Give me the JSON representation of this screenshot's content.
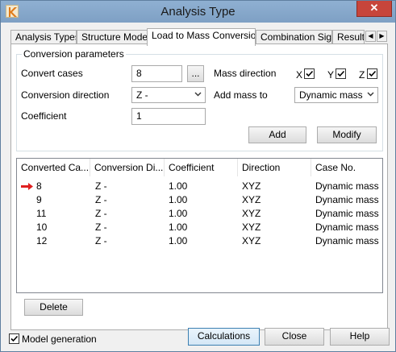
{
  "window": {
    "title": "Analysis Type"
  },
  "titlebar": {
    "close_glyph": "✕"
  },
  "tabs": [
    {
      "label": "Analysis Types"
    },
    {
      "label": "Structure Model"
    },
    {
      "label": "Load to Mass Conversion"
    },
    {
      "label": "Combination Sign"
    },
    {
      "label": "Result I"
    }
  ],
  "tab_scroll": {
    "left": "◀",
    "right": "▶"
  },
  "conversion": {
    "group_label": "Conversion parameters",
    "convert_cases_label": "Convert cases",
    "convert_cases_value": "8",
    "browse_label": "...",
    "direction_label": "Conversion direction",
    "direction_value": "Z -",
    "coefficient_label": "Coefficient",
    "coefficient_value": "1",
    "mass_direction_label": "Mass direction",
    "mass_x": "X",
    "mass_y": "Y",
    "mass_z": "Z",
    "add_mass_label": "Add mass to",
    "add_mass_value": "Dynamic mass",
    "add_button": "Add",
    "modify_button": "Modify"
  },
  "table": {
    "columns": [
      "Converted Ca...",
      "Conversion Di...",
      "Coefficient",
      "Direction",
      "Case No."
    ],
    "rows": [
      [
        "8",
        "Z -",
        "1.00",
        "XYZ",
        "Dynamic mass"
      ],
      [
        "9",
        "Z -",
        "1.00",
        "XYZ",
        "Dynamic mass"
      ],
      [
        "11",
        "Z -",
        "1.00",
        "XYZ",
        "Dynamic mass"
      ],
      [
        "10",
        "Z -",
        "1.00",
        "XYZ",
        "Dynamic mass"
      ],
      [
        "12",
        "Z -",
        "1.00",
        "XYZ",
        "Dynamic mass"
      ]
    ]
  },
  "delete_button": "Delete",
  "footer": {
    "model_generation_label": "Model generation",
    "calculations_button": "Calculations",
    "close_button": "Close",
    "help_button": "Help"
  },
  "colors": {
    "titlebar": "#8fb0d2",
    "close": "#c7453b",
    "row_arrow": "#e02020"
  },
  "icons": [
    "app-logo-icon",
    "close-icon",
    "chevron-down-icon",
    "checkmark-icon",
    "red-arrow-icon"
  ]
}
